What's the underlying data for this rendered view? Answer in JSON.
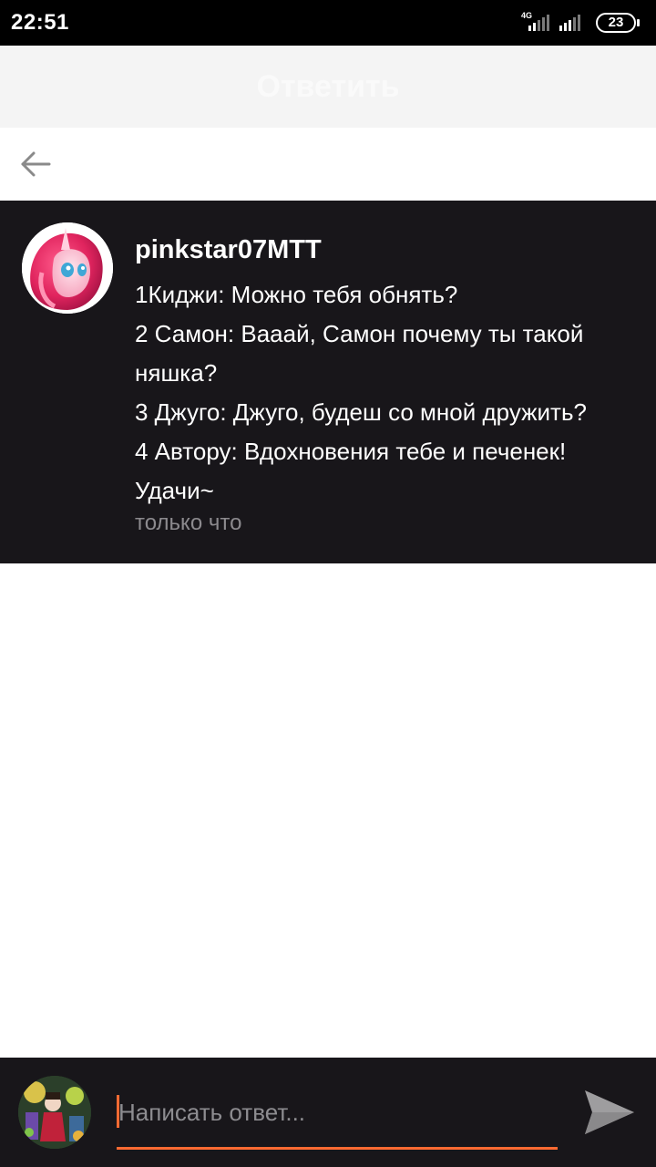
{
  "status_bar": {
    "time": "22:51",
    "network_label": "4G",
    "battery": "23"
  },
  "header": {
    "title": "Ответить"
  },
  "nav": {
    "back_icon": "arrow-left-icon"
  },
  "comment": {
    "author": "pinkstar07MTT",
    "lines": [
      "1Киджи: Можно тебя обнять?",
      "2 Самон: Вааай, Самон почему ты такой няшка?",
      "3 Джуго: Джуго, будеш со мной дружить?",
      "4 Автору: Вдохновения тебе и печенек! Удачи~"
    ],
    "time": "только что"
  },
  "reply": {
    "placeholder": "Написать ответ...",
    "send_icon": "send-icon"
  },
  "colors": {
    "accent": "#ff6a32",
    "dark_background": "#18161a",
    "muted_text": "#8c8a8e"
  }
}
